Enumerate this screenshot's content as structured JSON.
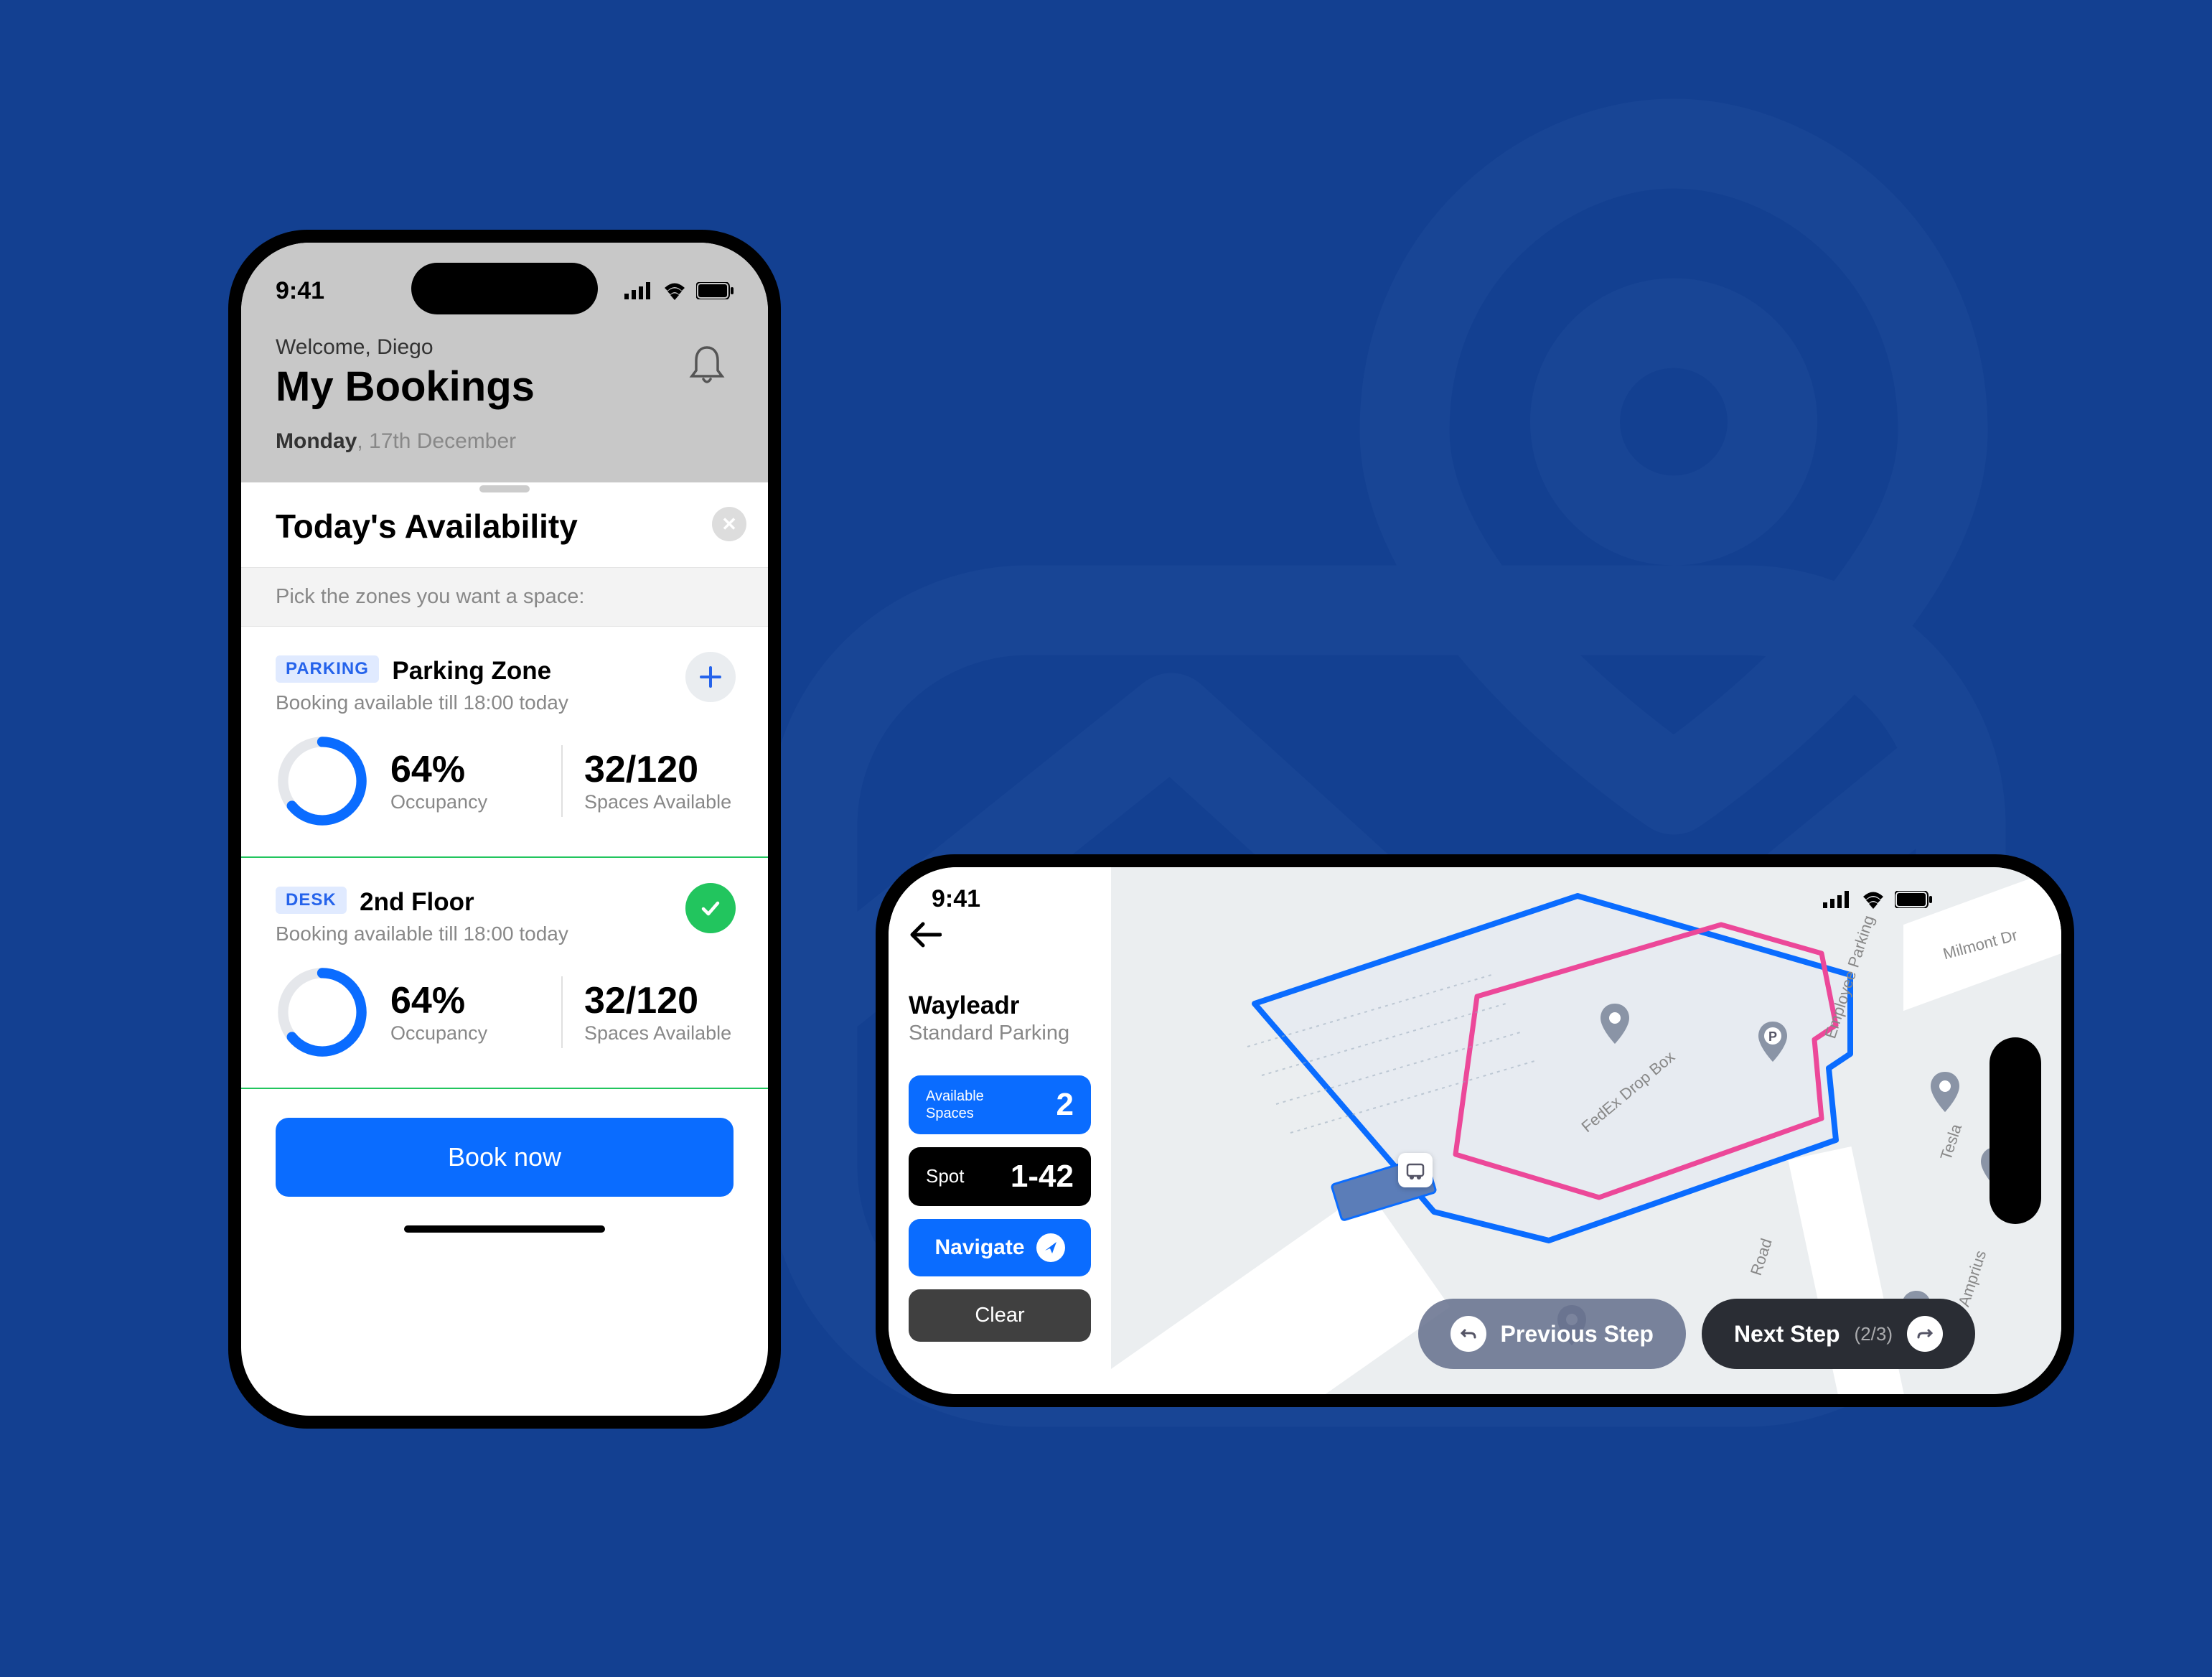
{
  "status": {
    "time": "9:41"
  },
  "header": {
    "welcome": "Welcome, Diego",
    "title": "My Bookings",
    "date_day": "Monday",
    "date_rest": ", 17th December"
  },
  "sheet": {
    "title": "Today's Availability",
    "subtitle": "Pick the zones you want a space:",
    "zones": [
      {
        "tag": "PARKING",
        "name": "Parking Zone",
        "availability": "Booking available till 18:00 today",
        "occupancy_pct": "64%",
        "occupancy_label": "Occupancy",
        "spaces": "32/120",
        "spaces_label": "Spaces Available",
        "action": "add"
      },
      {
        "tag": "DESK",
        "name": "2nd Floor",
        "availability": "Booking available till 18:00 today",
        "occupancy_pct": "64%",
        "occupancy_label": "Occupancy",
        "spaces": "32/120",
        "spaces_label": "Spaces Available",
        "action": "check"
      }
    ],
    "book_label": "Book now"
  },
  "nav": {
    "title": "Wayleadr",
    "subtitle": "Standard Parking",
    "available_label": "Available\nSpaces",
    "available_val": "2",
    "spot_label": "Spot",
    "spot_val": "1-42",
    "navigate_label": "Navigate",
    "clear_label": "Clear",
    "prev_label": "Previous Step",
    "next_label": "Next Step",
    "step_count": "(2/3)"
  },
  "map": {
    "labels": {
      "milmont": "Milmont Dr",
      "employee_parking": "Employee Parking",
      "fedex": "FedEx Drop Box",
      "tesla": "Tesla",
      "amprius": "Amprius",
      "road": "Road"
    }
  }
}
